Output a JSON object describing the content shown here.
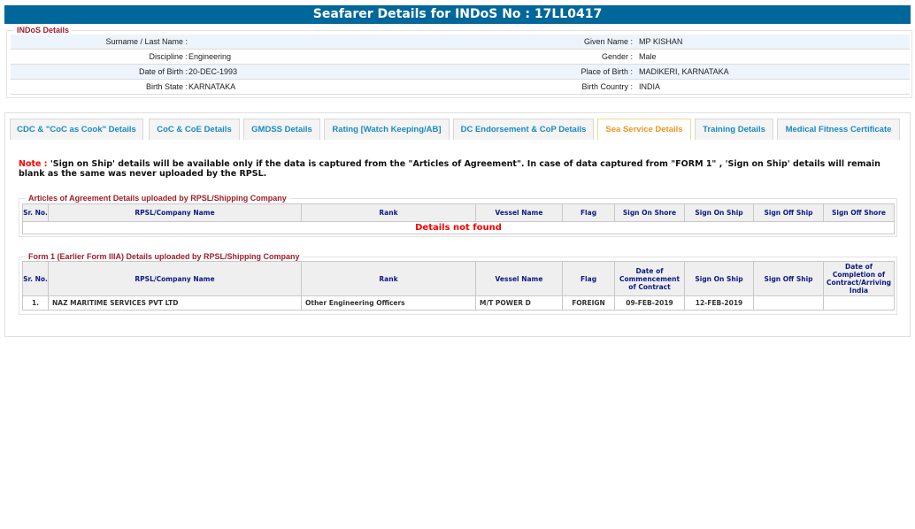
{
  "header": {
    "title": "Seafarer Details for INDoS No : 17LL0417"
  },
  "indos": {
    "legend": "INDoS Details",
    "rows": [
      {
        "l1": "Surname / Last Name :",
        "v1": "",
        "l2": "Given Name :",
        "v2": "MP KISHAN"
      },
      {
        "l1": "Discipline :",
        "v1": "Engineering",
        "l2": "Gender :",
        "v2": "Male"
      },
      {
        "l1": "Date of Birth :",
        "v1": "20-DEC-1993",
        "l2": "Place of Birth :",
        "v2": "MADIKERI, KARNATAKA"
      },
      {
        "l1": "Birth State :",
        "v1": "KARNATAKA",
        "l2": "Birth Country :",
        "v2": "INDIA"
      }
    ]
  },
  "tabs": [
    "CDC & \"CoC as Cook\" Details",
    "CoC & CoE Details",
    "GMDSS Details",
    "Rating [Watch Keeping/AB]",
    "DC Endorsement & CoP Details",
    "Sea Service Details",
    "Training Details",
    "Medical Fitness Certificate"
  ],
  "note": {
    "label": "Note :",
    "text": " 'Sign on Ship' details will be available only if the data is captured from the \"Articles of Agreement\". In case of data captured from \"FORM 1\" , 'Sign on Ship' details will remain blank as the same was never uploaded by the RPSL."
  },
  "aoa": {
    "legend": "Articles of Agreement Details uploaded by RPSL/Shipping Company",
    "headers": [
      "Sr. No.",
      "RPSL/Company Name",
      "Rank",
      "Vessel Name",
      "Flag",
      "Sign On Shore",
      "Sign On Ship",
      "Sign Off Ship",
      "Sign Off Shore"
    ],
    "empty": "Details not found"
  },
  "form1": {
    "legend": "Form 1 (Earlier Form IIIA) Details uploaded by RPSL/Shipping Company",
    "headers": [
      "Sr. No.",
      "RPSL/Company Name",
      "Rank",
      "Vessel Name",
      "Flag",
      "Date of Commencement of Contract",
      "Sign On Ship",
      "Sign Off Ship",
      "Date of Completion of Contract/Arriving India"
    ],
    "rows": [
      [
        "1.",
        "NAZ MARITIME SERVICES PVT LTD",
        "Other Engineering Officers",
        "M/T POWER D",
        "FOREIGN",
        "09-FEB-2019",
        "12-FEB-2019",
        "",
        ""
      ]
    ]
  }
}
